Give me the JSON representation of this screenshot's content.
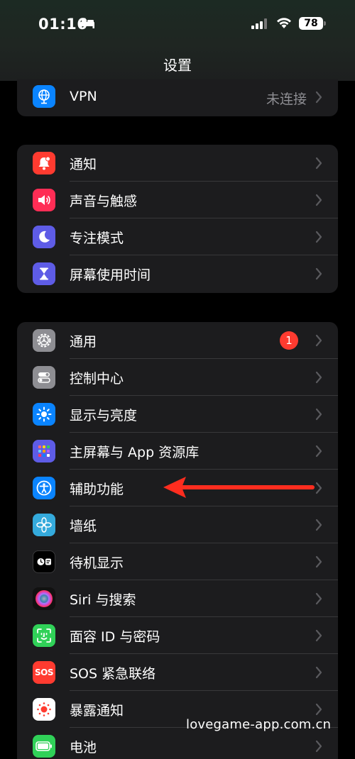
{
  "status": {
    "time": "01:16",
    "battery": "78"
  },
  "nav": {
    "title": "设置"
  },
  "vpn": {
    "label": "VPN",
    "value": "未连接"
  },
  "group2": [
    {
      "label": "通知",
      "icon": "bell-icon",
      "color": "#ff3b30"
    },
    {
      "label": "声音与触感",
      "icon": "speaker-icon",
      "color": "#ff2d55"
    },
    {
      "label": "专注模式",
      "icon": "moon-icon",
      "color": "#5e5ce6"
    },
    {
      "label": "屏幕使用时间",
      "icon": "hourglass-icon",
      "color": "#5e5ce6"
    }
  ],
  "group3": [
    {
      "label": "通用",
      "icon": "gear-icon",
      "color": "#8e8e93",
      "badge": "1"
    },
    {
      "label": "控制中心",
      "icon": "toggles-icon",
      "color": "#8e8e93"
    },
    {
      "label": "显示与亮度",
      "icon": "sun-icon",
      "color": "#0a84ff"
    },
    {
      "label": "主屏幕与 App 资源库",
      "icon": "app-grid-icon",
      "color": "#5e5ce6"
    },
    {
      "label": "辅助功能",
      "icon": "accessibility-icon",
      "color": "#0a84ff"
    },
    {
      "label": "墙纸",
      "icon": "flower-icon",
      "color": "#34aadc"
    },
    {
      "label": "待机显示",
      "icon": "standby-icon",
      "color": "#1c1c1e"
    },
    {
      "label": "Siri 与搜索",
      "icon": "siri-icon",
      "color": "#222"
    },
    {
      "label": "面容 ID 与密码",
      "icon": "faceid-icon",
      "color": "#30d158"
    },
    {
      "label": "SOS 紧急联络",
      "icon": "sos-icon",
      "color": "#ff3b30"
    },
    {
      "label": "暴露通知",
      "icon": "exposure-icon",
      "color": "#ffffff"
    },
    {
      "label": "电池",
      "icon": "battery-icon",
      "color": "#30d158"
    }
  ],
  "sos_text": "SOS",
  "watermark": "lovegame-app.com.cn"
}
